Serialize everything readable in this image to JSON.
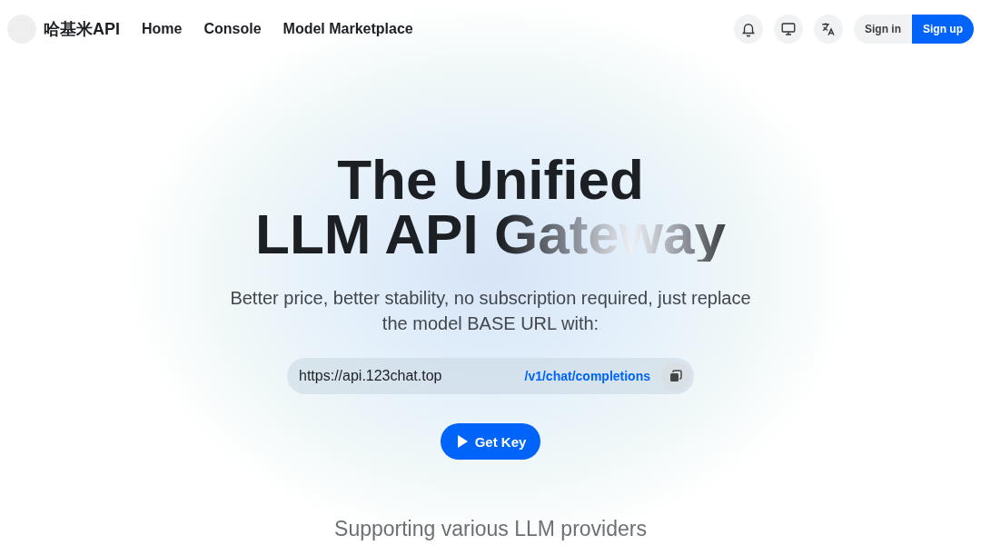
{
  "nav": {
    "brand": "哈基米API",
    "links": [
      {
        "label": "Home"
      },
      {
        "label": "Console"
      },
      {
        "label": "Model Marketplace"
      }
    ],
    "sign_in": "Sign in",
    "sign_up": "Sign up"
  },
  "hero": {
    "title_lines": [
      "The Unified",
      "LLM API Gateway"
    ],
    "subtitle": "Better price, better stability, no subscription required, just replace the model BASE URL with:",
    "base_url": "https://api.123chat.top",
    "endpoint": "/v1/chat/completions",
    "cta": "Get Key"
  },
  "providers_heading": "Supporting various LLM providers"
}
